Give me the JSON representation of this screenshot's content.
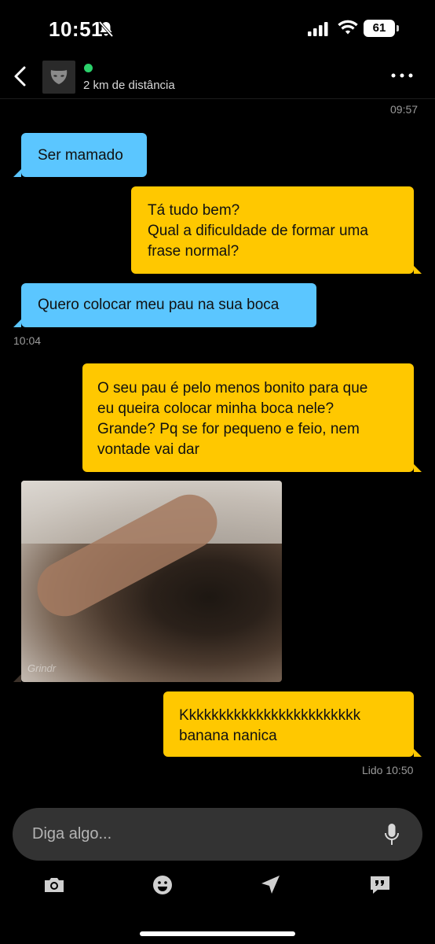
{
  "status_bar": {
    "time": "10:51",
    "battery": "61",
    "icons": [
      "bell-off-icon",
      "cellular-signal-icon",
      "wifi-icon",
      "battery-icon"
    ]
  },
  "header": {
    "distance": "2 km de distância",
    "online_color": "#2bd16b",
    "icons": [
      "back-chevron-icon",
      "grindr-mask-icon",
      "more-horizontal-icon"
    ]
  },
  "messages": [
    {
      "type": "timestamp",
      "text": "09:57"
    },
    {
      "type": "incoming",
      "lines": [
        "Ser mamado"
      ]
    },
    {
      "type": "outgoing",
      "lines": [
        "Tá tudo bem?",
        "Qual a dificuldade de formar uma",
        "frase normal?"
      ]
    },
    {
      "type": "incoming",
      "lines": [
        "Quero colocar meu pau na sua boca"
      ]
    },
    {
      "type": "timestamp",
      "text": "10:04"
    },
    {
      "type": "outgoing",
      "lines": [
        "O seu pau é pelo menos bonito para que",
        "eu queira colocar minha boca nele?",
        "Grande? Pq se for pequeno e feio, nem",
        "vontade vai dar"
      ]
    },
    {
      "type": "incoming-image",
      "watermark": "Grindr"
    },
    {
      "type": "outgoing",
      "lines": [
        "Kkkkkkkkkkkkkkkkkkkkkkkk",
        "banana nanica"
      ]
    },
    {
      "type": "read-receipt",
      "text": "Lido 10:50"
    }
  ],
  "input": {
    "placeholder": "Diga algo..."
  },
  "toolbar": [
    "camera-icon",
    "emoji-icon",
    "location-arrow-icon",
    "saved-phrases-icon"
  ],
  "colors": {
    "incoming_bubble": "#5bc6ff",
    "outgoing_bubble": "#ffc800",
    "background": "#000000"
  }
}
